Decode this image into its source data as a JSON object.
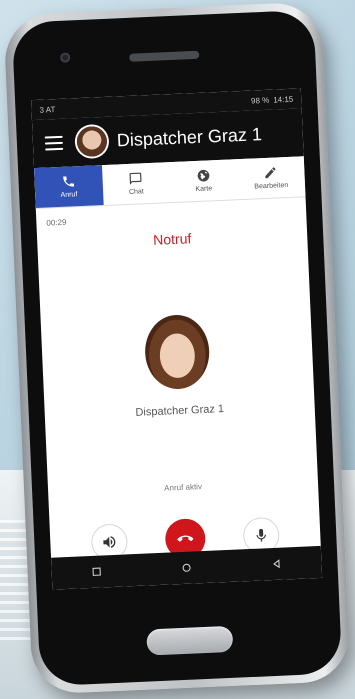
{
  "status_bar": {
    "carrier": "3 AT",
    "right_text": "98 %",
    "time": "14:15"
  },
  "header": {
    "title": "Dispatcher Graz 1",
    "avatar_icon": "user-avatar-icon"
  },
  "tabs": [
    {
      "label": "Anruf",
      "icon": "phone-icon",
      "active": true
    },
    {
      "label": "Chat",
      "icon": "chat-icon",
      "active": false
    },
    {
      "label": "Karte",
      "icon": "globe-icon",
      "active": false
    },
    {
      "label": "Bearbeiten",
      "icon": "pencil-icon",
      "active": false
    }
  ],
  "call": {
    "timer": "00:29",
    "type": "Notruf",
    "caller_name": "Dispatcher Graz 1",
    "status": "Anruf aktiv"
  },
  "controls": {
    "speaker_icon": "speaker-icon",
    "hangup_icon": "hangup-icon",
    "mic_icon": "microphone-icon"
  },
  "colors": {
    "accent": "#3153b7",
    "alert_red": "#c8202a",
    "hangup_red": "#d0161d"
  }
}
